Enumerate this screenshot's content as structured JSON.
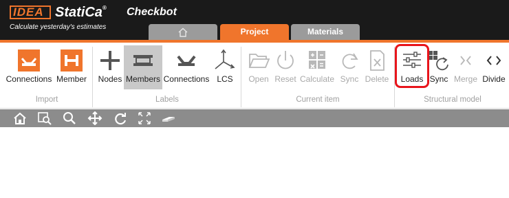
{
  "header": {
    "logo_mark": "IDEA",
    "logo_text": "StatiCa",
    "logo_reg": "®",
    "app_title": "Checkbot",
    "tagline": "Calculate yesterday's estimates"
  },
  "tabs": [
    {
      "label": "",
      "icon": "home-icon"
    },
    {
      "label": "Project"
    },
    {
      "label": "Materials"
    }
  ],
  "colors": {
    "accent": "#f0752c",
    "header_bg": "#1a1a1a",
    "toolbar_bg": "#8c8c8c",
    "highlight": "#e8141b"
  },
  "ribbon": {
    "groups": [
      {
        "label": "Import",
        "buttons": [
          "Connections",
          "Member"
        ]
      },
      {
        "label": "Labels",
        "buttons": [
          "Nodes",
          "Members",
          "Connections",
          "LCS"
        ]
      },
      {
        "label": "Current item",
        "buttons": [
          "Open",
          "Reset",
          "Calculate",
          "Sync",
          "Delete"
        ]
      },
      {
        "label": "Structural model",
        "buttons": [
          "Loads",
          "Sync",
          "Merge",
          "Divide"
        ]
      }
    ]
  },
  "toolbar": {
    "tools": [
      "home-view-icon",
      "zoom-window-icon",
      "zoom-icon",
      "pan-icon",
      "rotate-icon",
      "fit-icon",
      "solid-view-icon"
    ]
  }
}
